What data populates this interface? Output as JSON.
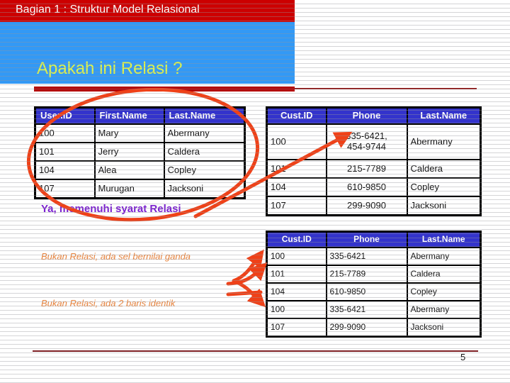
{
  "slide": {
    "title": "Bagian 1 : Struktur Model Relasional",
    "subtitle": "Apakah ini Relasi ?",
    "page_number": "5",
    "colors": {
      "title_bar": "#cc0000",
      "blue_block": "#3399f5",
      "subtitle_text": "#ddf24d",
      "table_header": "#3333cc",
      "ink_red": "#ef4118",
      "note_ok": "#7a1fcf",
      "note_bad": "#e8833c",
      "rule_thick": "#b30000",
      "footer_rule": "#7e2024"
    }
  },
  "tables": {
    "users": {
      "columns": [
        "User.ID",
        "First.Name",
        "Last.Name"
      ],
      "rows": [
        [
          "100",
          "Mary",
          "Abermany"
        ],
        [
          "101",
          "Jerry",
          "Caldera"
        ],
        [
          "104",
          "Alea",
          "Copley"
        ],
        [
          "107",
          "Murugan",
          "Jacksoni"
        ]
      ]
    },
    "customers_multivalued": {
      "columns": [
        "Cust.ID",
        "Phone",
        "Last.Name"
      ],
      "rows": [
        [
          "100",
          "335-6421,\n454-9744",
          "Abermany"
        ],
        [
          "101",
          "215-7789",
          "Caldera"
        ],
        [
          "104",
          "610-9850",
          "Copley"
        ],
        [
          "107",
          "299-9090",
          "Jacksoni"
        ]
      ],
      "multivalued_cell": {
        "line1": "335-6421,",
        "line2": "454-9744"
      }
    },
    "customers_duplicate": {
      "columns": [
        "Cust.ID",
        "Phone",
        "Last.Name"
      ],
      "rows": [
        [
          "100",
          "335-6421",
          "Abermany"
        ],
        [
          "101",
          "215-7789",
          "Caldera"
        ],
        [
          "104",
          "610-9850",
          "Copley"
        ],
        [
          "100",
          "335-6421",
          "Abermany"
        ],
        [
          "107",
          "299-9090",
          "Jacksoni"
        ]
      ]
    }
  },
  "annotations": {
    "ok": "Ya, memenuhi syarat Relasi",
    "multivalued": "Bukan Relasi, ada sel bernilai ganda",
    "duplicate": "Bukan Relasi, ada 2 baris identik"
  }
}
